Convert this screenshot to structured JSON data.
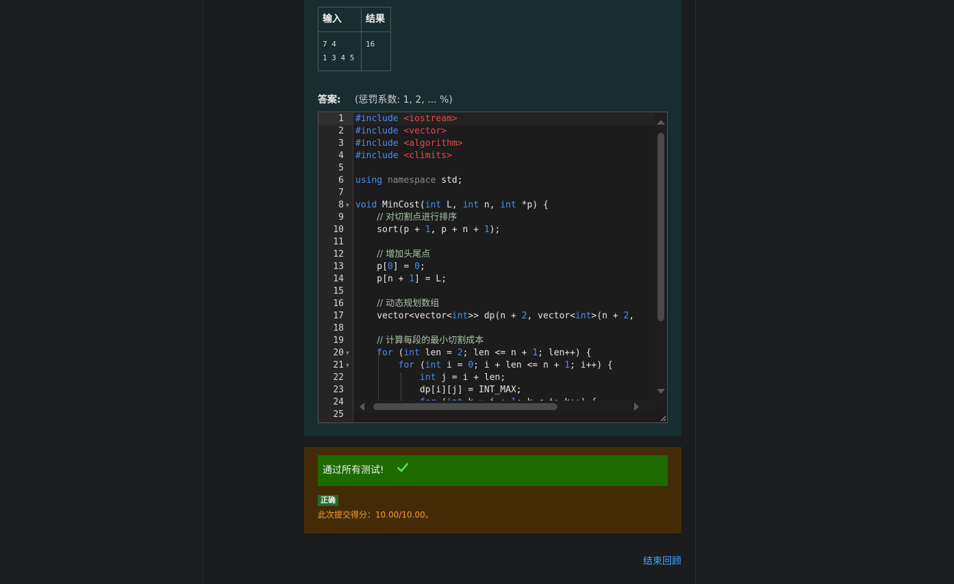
{
  "testcase_table": {
    "headers": [
      "输入",
      "结果"
    ],
    "rows": [
      {
        "input": "7 4\n1 3 4 5",
        "result": "16"
      }
    ]
  },
  "answer": {
    "label": "答案:",
    "penalty": "(惩罚系数: 1, 2, ... %)"
  },
  "editor": {
    "lines": [
      {
        "n": "1",
        "fold": ""
      },
      {
        "n": "2",
        "fold": ""
      },
      {
        "n": "3",
        "fold": ""
      },
      {
        "n": "4",
        "fold": ""
      },
      {
        "n": "5",
        "fold": ""
      },
      {
        "n": "6",
        "fold": ""
      },
      {
        "n": "7",
        "fold": ""
      },
      {
        "n": "8",
        "fold": "▼"
      },
      {
        "n": "9",
        "fold": ""
      },
      {
        "n": "10",
        "fold": ""
      },
      {
        "n": "11",
        "fold": ""
      },
      {
        "n": "12",
        "fold": ""
      },
      {
        "n": "13",
        "fold": ""
      },
      {
        "n": "14",
        "fold": ""
      },
      {
        "n": "15",
        "fold": ""
      },
      {
        "n": "16",
        "fold": ""
      },
      {
        "n": "17",
        "fold": ""
      },
      {
        "n": "18",
        "fold": ""
      },
      {
        "n": "19",
        "fold": ""
      },
      {
        "n": "20",
        "fold": "▼"
      },
      {
        "n": "21",
        "fold": "▼"
      },
      {
        "n": "22",
        "fold": ""
      },
      {
        "n": "23",
        "fold": ""
      },
      {
        "n": "24",
        "fold": ""
      },
      {
        "n": "25",
        "fold": ""
      }
    ],
    "code": [
      [
        [
          "inc",
          "#include "
        ],
        [
          "str",
          "<iostream>"
        ]
      ],
      [
        [
          "inc",
          "#include "
        ],
        [
          "str",
          "<vector>"
        ]
      ],
      [
        [
          "inc",
          "#include "
        ],
        [
          "str",
          "<algorithm>"
        ]
      ],
      [
        [
          "inc",
          "#include "
        ],
        [
          "str",
          "<climits>"
        ]
      ],
      [],
      [
        [
          "kw",
          "using "
        ],
        [
          "ns",
          "namespace "
        ],
        [
          "op",
          "std;"
        ]
      ],
      [],
      [
        [
          "kw",
          "void "
        ],
        [
          "op",
          "MinCost("
        ],
        [
          "kw",
          "int "
        ],
        [
          "op",
          "L, "
        ],
        [
          "kw",
          "int "
        ],
        [
          "op",
          "n, "
        ],
        [
          "kw",
          "int "
        ],
        [
          "op",
          "*p) {"
        ]
      ],
      [
        [
          "op",
          "    "
        ],
        [
          "cmt",
          "// 对切割点进行排序"
        ]
      ],
      [
        [
          "op",
          "    sort(p + "
        ],
        [
          "numc",
          "1"
        ],
        [
          "op",
          ", p + n + "
        ],
        [
          "numc",
          "1"
        ],
        [
          "op",
          ");"
        ]
      ],
      [],
      [
        [
          "op",
          "    "
        ],
        [
          "cmt",
          "// 增加头尾点"
        ]
      ],
      [
        [
          "op",
          "    p["
        ],
        [
          "numc",
          "0"
        ],
        [
          "op",
          "] = "
        ],
        [
          "numc",
          "0"
        ],
        [
          "op",
          ";"
        ]
      ],
      [
        [
          "op",
          "    p[n + "
        ],
        [
          "numc",
          "1"
        ],
        [
          "op",
          "] = L;"
        ]
      ],
      [],
      [
        [
          "op",
          "    "
        ],
        [
          "cmt",
          "// 动态规划数组"
        ]
      ],
      [
        [
          "op",
          "    vector<vector<"
        ],
        [
          "kw",
          "int"
        ],
        [
          "op",
          ">> dp(n + "
        ],
        [
          "numc",
          "2"
        ],
        [
          "op",
          ", vector<"
        ],
        [
          "kw",
          "int"
        ],
        [
          "op",
          ">(n + "
        ],
        [
          "numc",
          "2"
        ],
        [
          "op",
          ","
        ]
      ],
      [],
      [
        [
          "op",
          "    "
        ],
        [
          "cmt",
          "// 计算每段的最小切割成本"
        ]
      ],
      [
        [
          "op",
          "    "
        ],
        [
          "kw",
          "for "
        ],
        [
          "op",
          "("
        ],
        [
          "kw",
          "int "
        ],
        [
          "op",
          "len = "
        ],
        [
          "numc",
          "2"
        ],
        [
          "op",
          "; len <= n + "
        ],
        [
          "numc",
          "1"
        ],
        [
          "op",
          "; len++) {"
        ]
      ],
      [
        [
          "op",
          "        "
        ],
        [
          "kw",
          "for "
        ],
        [
          "op",
          "("
        ],
        [
          "kw",
          "int "
        ],
        [
          "op",
          "i = "
        ],
        [
          "numc",
          "0"
        ],
        [
          "op",
          "; i + len <= n + "
        ],
        [
          "numc",
          "1"
        ],
        [
          "op",
          "; i++) {"
        ]
      ],
      [
        [
          "op",
          "            "
        ],
        [
          "kw",
          "int "
        ],
        [
          "op",
          "j = i + len;"
        ]
      ],
      [
        [
          "op",
          "            dp[i][j] = INT_MAX;"
        ]
      ],
      [
        [
          "op",
          "            "
        ],
        [
          "kw",
          "for "
        ],
        [
          "op",
          "("
        ],
        [
          "kw",
          "int "
        ],
        [
          "op",
          "k = i + "
        ],
        [
          "numc",
          "1"
        ],
        [
          "op",
          "; k < j; k++) {"
        ]
      ],
      [
        [
          "op",
          "                "
        ]
      ]
    ]
  },
  "feedback": {
    "pass_text": "通过所有测试!",
    "badge": "正确",
    "score": "此次提交得分：10.00/10.00。"
  },
  "finish_link": "结束回顾",
  "colors": {
    "question_bg": "#172d30",
    "feedback_bg": "#442b07",
    "pass_green": "#1c6b00",
    "link_blue": "#4aa3ff"
  }
}
